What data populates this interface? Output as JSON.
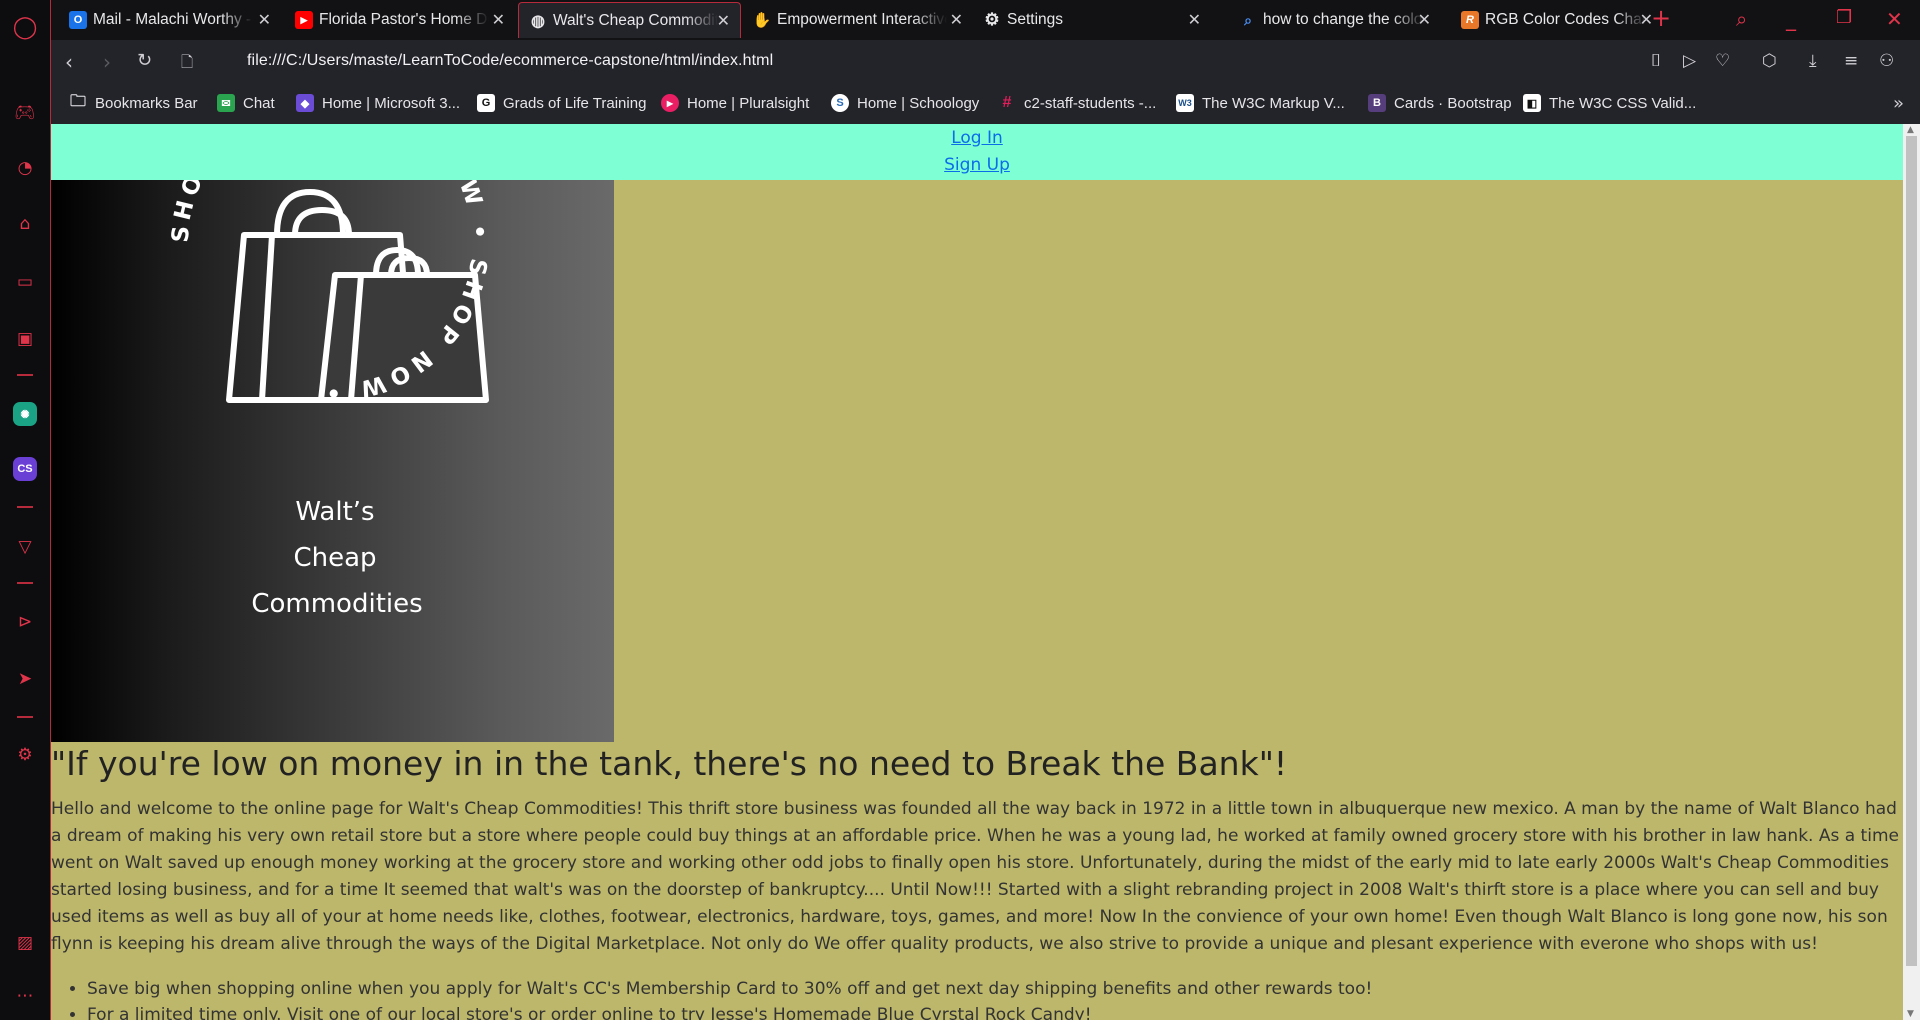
{
  "sidebar": {
    "items": [
      {
        "name": "opera-logo-icon"
      },
      {
        "name": "gamepad-icon"
      },
      {
        "name": "speedometer-icon"
      },
      {
        "name": "store-icon"
      },
      {
        "name": "twitch-icon"
      },
      {
        "name": "cpu-icon"
      },
      {
        "name": "chatgpt-icon"
      },
      {
        "name": "cs-app-icon",
        "label": "CS"
      },
      {
        "name": "vee-icon"
      },
      {
        "name": "play-circle-icon"
      },
      {
        "name": "send-icon"
      },
      {
        "name": "settings-icon"
      },
      {
        "name": "gallery-icon"
      },
      {
        "name": "more-icon"
      }
    ]
  },
  "tabs": [
    {
      "title": "Mail - Malachi Worthy - Outlook",
      "favicon": "outlook-icon",
      "color": "#1a73e8",
      "letter": "O"
    },
    {
      "title": "Florida Pastor's Home Destroyed",
      "favicon": "youtube-icon",
      "color": "#ff0000",
      "letter": "▶"
    },
    {
      "title": "Walt's Cheap Commodities",
      "favicon": "globe-icon",
      "color": "#2b2b33",
      "letter": "◍",
      "active": true
    },
    {
      "title": "Empowerment Interactive",
      "favicon": "hand-icon",
      "color": "#e8a53a",
      "letter": "✋"
    },
    {
      "title": "Settings",
      "favicon": "gear-icon",
      "color": "#23232a",
      "letter": "⚙"
    },
    {
      "title": "how to change the color",
      "favicon": "search-icon",
      "color": "#121215",
      "letter": "🔍"
    },
    {
      "title": "RGB Color Codes Chart",
      "favicon": "rgb-icon",
      "color": "#e8772a",
      "letter": "R"
    }
  ],
  "address": {
    "url": "file:///C:/Users/maste/LearnToCode/ecommerce-capstone/html/index.html"
  },
  "bookmarks": [
    {
      "label": "Bookmarks Bar",
      "icon": "folder-icon",
      "color": "#23232a",
      "letter": "🗀"
    },
    {
      "label": "Chat",
      "icon": "chat-icon",
      "color": "#2aa44f",
      "letter": "💬"
    },
    {
      "label": "Home | Microsoft 3...",
      "icon": "microsoft-icon",
      "color": "#6a4cd6",
      "letter": "◆"
    },
    {
      "label": "Grads of Life Training",
      "icon": "grads-icon",
      "color": "#ffffff",
      "letter": "G"
    },
    {
      "label": "Home | Pluralsight",
      "icon": "pluralsight-icon",
      "color": "#e91e63",
      "letter": "▶"
    },
    {
      "label": "Home | Schoology",
      "icon": "schoology-icon",
      "color": "#ffffff",
      "letter": "S"
    },
    {
      "label": "c2-staff-students -...",
      "icon": "slack-icon",
      "color": "#4a154b",
      "letter": "#"
    },
    {
      "label": "The W3C Markup V...",
      "icon": "w3c-icon",
      "color": "#ffffff",
      "letter": "W3"
    },
    {
      "label": "Cards · Bootstrap",
      "icon": "bootstrap-icon",
      "color": "#563d7c",
      "letter": "B"
    },
    {
      "label": "The W3C CSS Valid...",
      "icon": "w3c-css-icon",
      "color": "#111111",
      "letter": "◧"
    }
  ],
  "page": {
    "login_label": "Log In",
    "signup_label": "Sign Up",
    "logo": {
      "ring_text": "SHOP NOW • SHOP NOW • SHOP NOW • ",
      "line1": "Walt’s",
      "line2": "Cheap",
      "line3": "Commodities"
    },
    "headline": "\"If you're low on money in in the tank, there's no need to Break the Bank\"!",
    "intro": "Hello and welcome to the online page for Walt's Cheap Commodities! This thrift store business was founded all the way back in 1972 in a little town in albuquerque new mexico. A man by the name of Walt Blanco had a dream of making his very own retail store but a store where people could buy things at an affordable price. When he was a young lad, he worked at family owned grocery store with his brother in law hank. As a time went on Walt saved up enough money working at the grocery store and working other odd jobs to finally open his store. Unfortunately, during the midst of the early mid to late early 2000s Walt's Cheap Commodities started losing business, and for a time It seemed that walt's was on the doorstep of bankruptcy.... Until Now!!! Started with a slight rebranding project in 2008 Walt's thirft store is a place where you can sell and buy used items as well as buy all of your at home needs like, clothes, footwear, electronics, hardware, toys, games, and more! Now In the convience of your own home! Even though Walt Blanco is long gone now, his son flynn is keeping his dream alive through the ways of the Digital Marketplace. Not only do We offer quality products, we also strive to provide a unique and plesant experience with everone who shops with us!",
    "perks": [
      "Save big when shopping online when you apply for Walt's CC's Membership Card to 30% off and get next day shipping benefits and other rewards too!",
      "For a limited time only. Visit one of our local store's or order online to try Jesse's Homemade Blue Cyrstal Rock Candy!"
    ]
  },
  "colors": {
    "accent": "#e0344a",
    "page_bg": "#bdb76b",
    "auth_bg": "#7fffd4",
    "link": "#0b6ee8"
  }
}
